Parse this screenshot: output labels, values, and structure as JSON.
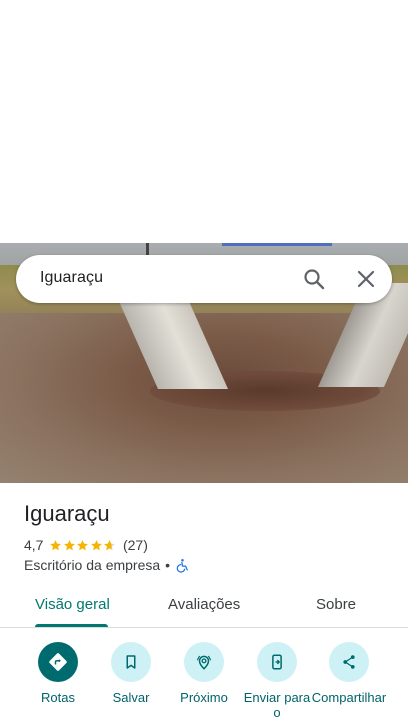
{
  "search": {
    "query": "Iguaraçu"
  },
  "place": {
    "name": "Iguaraçu",
    "rating": "4,7",
    "stars": 4.7,
    "review_count": "(27)",
    "category": "Escritório da empresa",
    "separator": "•"
  },
  "tabs": [
    {
      "label": "Visão geral",
      "active": true
    },
    {
      "label": "Avaliações",
      "active": false
    },
    {
      "label": "Sobre",
      "active": false
    }
  ],
  "actions": [
    {
      "label": "Rotas",
      "icon": "directions-icon"
    },
    {
      "label": "Salvar",
      "icon": "bookmark-icon"
    },
    {
      "label": "Próximo",
      "icon": "nearby-icon"
    },
    {
      "label": "Enviar para o",
      "icon": "send-to-phone-icon"
    },
    {
      "label": "Compartilhar",
      "icon": "share-icon"
    }
  ],
  "colors": {
    "accent": "#00786f",
    "action_bg": "#cdf1f5",
    "primary_action_bg": "#006b6e",
    "star": "#f4b400",
    "accessibility": "#1a73e8"
  }
}
